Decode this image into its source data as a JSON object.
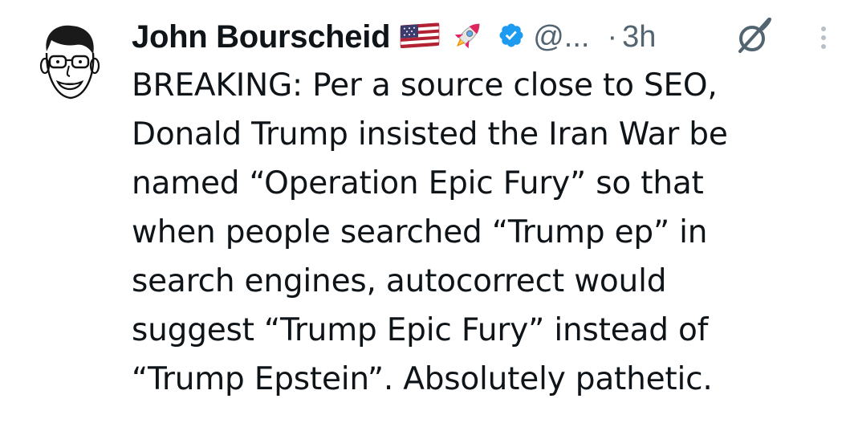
{
  "author": {
    "name": "John Bourscheid",
    "handle": "@...",
    "separator": "·",
    "time": "3h",
    "flag_icon": "us-flag-icon",
    "rocket_icon": "rocket-icon",
    "verified_icon": "verified-badge-icon",
    "verified_color": "#1d9bf0"
  },
  "actions": {
    "grok_icon": "grok-icon",
    "more_icon": "more-options-icon"
  },
  "tweet": {
    "text": "BREAKING: Per a source close to SEO,\nDonald Trump insisted the Iran War be\nnamed “Operation Epic Fury” so that\nwhen people searched “Trump ep” in\nsearch engines, autocorrect would\nsuggest “Trump Epic Fury” instead of\n“Trump Epstein”. Absolutely pathetic."
  },
  "colors": {
    "text": "#0f1419",
    "secondary": "#536471",
    "accent": "#1d9bf0"
  }
}
